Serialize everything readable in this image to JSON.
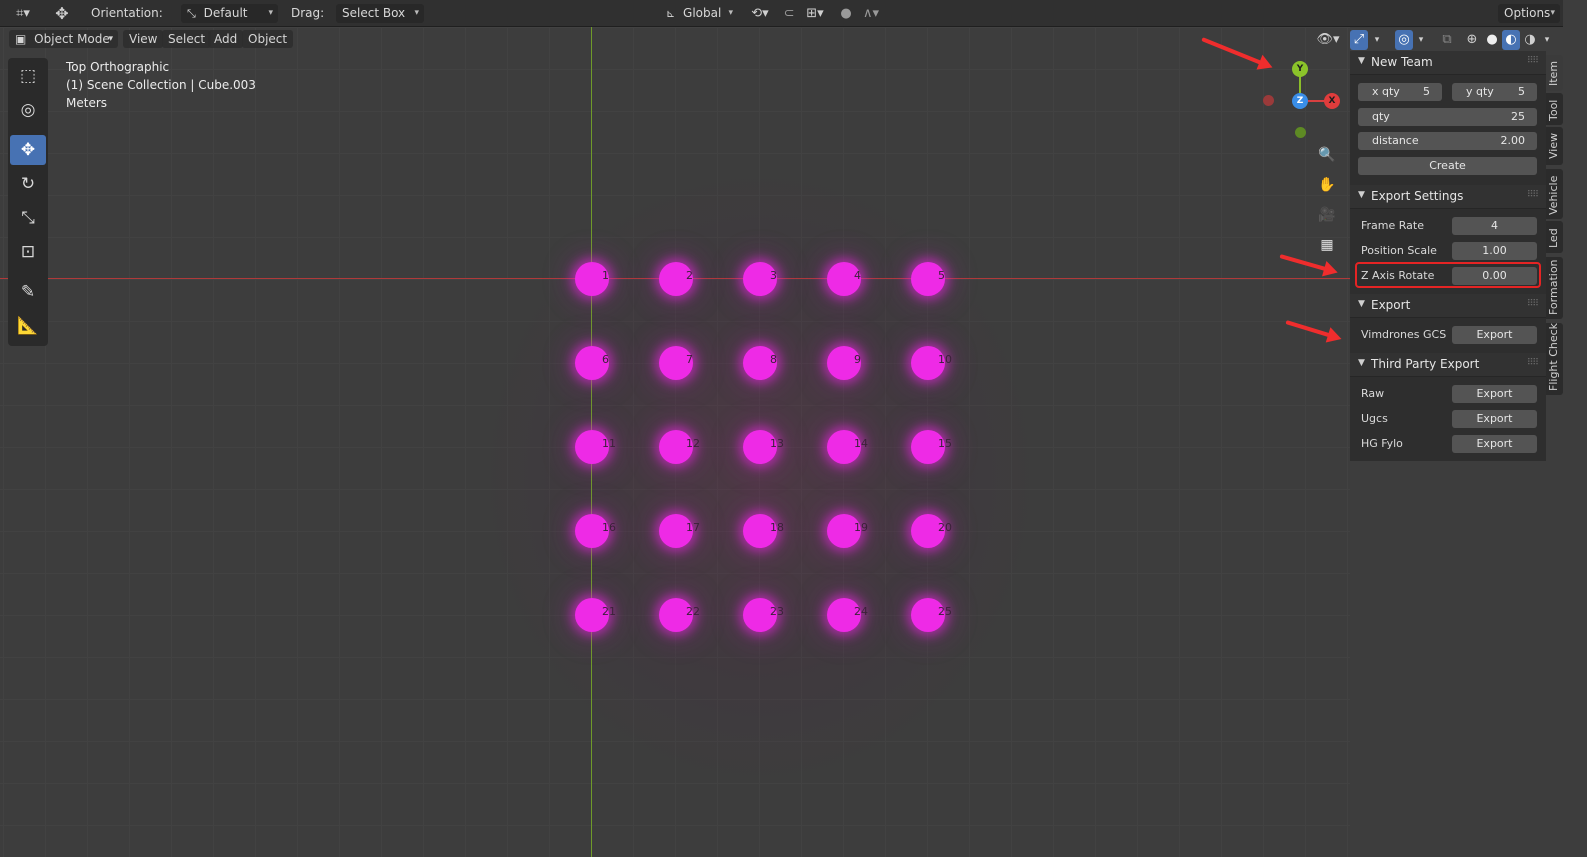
{
  "header": {
    "orientation_label": "Orientation:",
    "orientation_value": "Default",
    "drag_label": "Drag:",
    "drag_value": "Select Box",
    "transform_space": "Global",
    "options_label": "Options"
  },
  "menu": {
    "mode": "Object Mode",
    "items": [
      "View",
      "Select",
      "Add",
      "Object"
    ]
  },
  "viewport": {
    "view_name": "Top Orthographic",
    "collection": "(1) Scene Collection | Cube.003",
    "units": "Meters",
    "drones": [
      "1",
      "2",
      "3",
      "4",
      "5",
      "6",
      "7",
      "8",
      "9",
      "10",
      "11",
      "12",
      "13",
      "14",
      "15",
      "16",
      "17",
      "18",
      "19",
      "20",
      "21",
      "22",
      "23",
      "24",
      "25"
    ]
  },
  "gizmo": {
    "y": "Y",
    "z": "Z",
    "x": "X"
  },
  "panel": {
    "new_team": {
      "title": "New Team",
      "x_qty_label": "x qty",
      "x_qty": "5",
      "y_qty_label": "y qty",
      "y_qty": "5",
      "qty_label": "qty",
      "qty": "25",
      "distance_label": "distance",
      "distance": "2.00",
      "create_label": "Create"
    },
    "export_settings": {
      "title": "Export Settings",
      "frame_rate_label": "Frame Rate",
      "frame_rate": "4",
      "position_scale_label": "Position Scale",
      "position_scale": "1.00",
      "z_axis_rotate_label": "Z Axis Rotate",
      "z_axis_rotate": "0.00"
    },
    "export": {
      "title": "Export",
      "vimdrones_label": "Vimdrones GCS",
      "export_button": "Export"
    },
    "third_party": {
      "title": "Third Party Export",
      "raw_label": "Raw",
      "ugcs_label": "Ugcs",
      "hg_label": "HG Fylo",
      "export_button": "Export"
    }
  },
  "tabs": [
    "Item",
    "Tool",
    "View",
    "Vehicle",
    "Led",
    "Formation",
    "Flight Check"
  ],
  "colors": {
    "drone": "#ee2ae6",
    "accent": "#4772b3",
    "highlight": "#e52424"
  }
}
